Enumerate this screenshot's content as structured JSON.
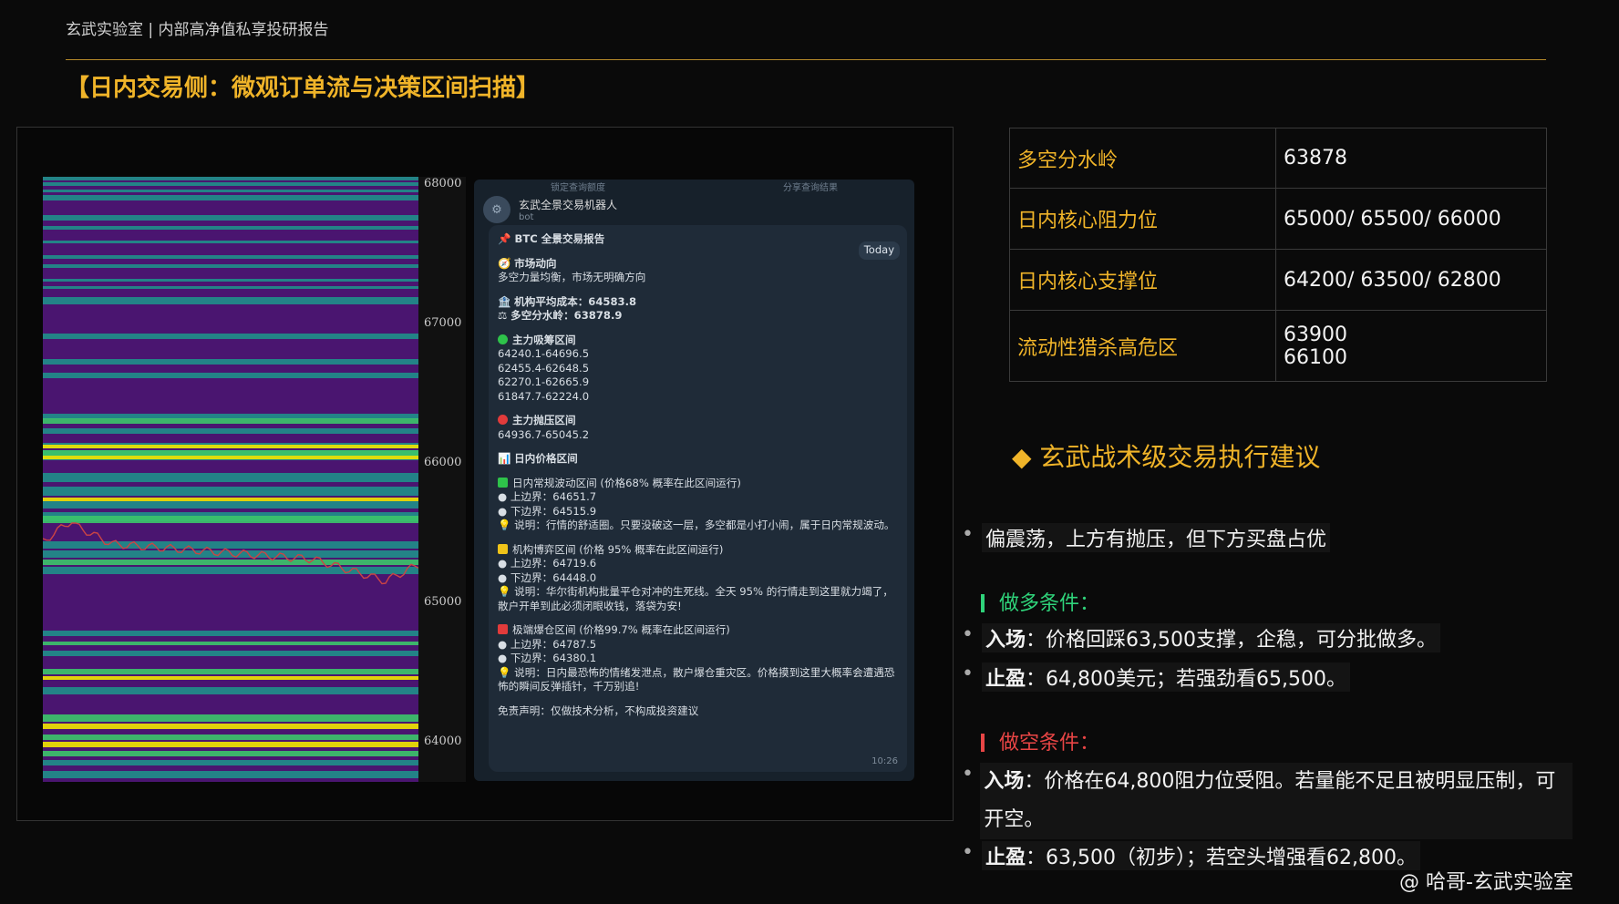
{
  "header": {
    "subtitle": "玄武实验室 | 内部高净值私享投研报告",
    "title": "【日内交易侧：微观订单流与决策区间扫描】"
  },
  "heatmap": {
    "y_ticks": [
      "68000",
      "67000",
      "66000",
      "65000",
      "64000"
    ],
    "colors": {
      "bg": "#4a1570",
      "teal": "#1f8f8a",
      "green": "#3cc56a",
      "yellow": "#f2e600"
    }
  },
  "chat": {
    "top_left": "锁定查询额度",
    "top_right": "分享查询结果",
    "bot_name": "玄武全景交易机器人",
    "bot_sub": "bot",
    "today": "Today",
    "title": "BTC 全景交易报告",
    "market_title": "市场动向",
    "market_text": "多空力量均衡，市场无明确方向",
    "cost_line": "机构平均成本：64583.8",
    "divide_line": "多空分水岭：63878.9",
    "absorb_title": "主力吸筹区间",
    "absorb": [
      "64240.1-64696.5",
      "62455.4-62648.5",
      "62270.1-62665.9",
      "61847.7-62224.0"
    ],
    "press_title": "主力抛压区间",
    "press": [
      "64936.7-65045.2"
    ],
    "range_title": "日内价格区间",
    "normal_title": "日内常规波动区间 (价格68% 概率在此区间运行)",
    "normal_up": "上边界：64651.7",
    "normal_down": "下边界：64515.9",
    "normal_note": "说明：行情的舒适圈。只要没破这一层，多空都是小打小闹，属于日内常规波动。",
    "inst_title": "机构博弈区间 (价格 95% 概率在此区间运行)",
    "inst_up": "上边界：64719.6",
    "inst_down": "下边界：64448.0",
    "inst_note": "说明：华尔街机构批量平仓对冲的生死线。全天 95% 的行情走到这里就力竭了，散户开单到此必须闭眼收钱，落袋为安!",
    "ext_title": "极端爆仓区间 (价格99.7% 概率在此区间运行)",
    "ext_up": "上边界：64787.5",
    "ext_down": "下边界：64380.1",
    "ext_note": "说明：日内最恐怖的情绪发泄点，散户爆仓重灾区。价格摸到这里大概率会遭遇恐怖的瞬间反弹插针，千万别追!",
    "disclaimer": "免责声明：仅做技术分析，不构成投资建议",
    "time": "10:26"
  },
  "table": [
    {
      "k": "多空分水岭",
      "v": "63878"
    },
    {
      "k": "日内核心阻力位",
      "v": "65000/ 65500/ 66000"
    },
    {
      "k": "日内核心支撑位",
      "v": "64200/ 63500/ 62800"
    },
    {
      "k": "流动性猎杀高危区",
      "v": "63900",
      "v2": "66100"
    }
  ],
  "advice": {
    "title": "◆ 玄武战术级交易执行建议",
    "bias": "偏震荡，上方有抛压，但下方买盘占优",
    "long_title": "做多条件：",
    "long_entry_k": "入场",
    "long_entry": "：价格回踩63,500支撑，企稳，可分批做多。",
    "long_tp_k": "止盈",
    "long_tp": "：64,800美元；若强劲看65,500。",
    "short_title": "做空条件：",
    "short_entry_k": "入场",
    "short_entry": "：价格在64,800阻力位受阻。若量能不足且被明显压制，可开空。",
    "short_tp_k": "止盈",
    "short_tp": "：63,500（初步）；若空头增强看62,800。"
  },
  "watermark": "@ 哈哥-玄武实验室"
}
